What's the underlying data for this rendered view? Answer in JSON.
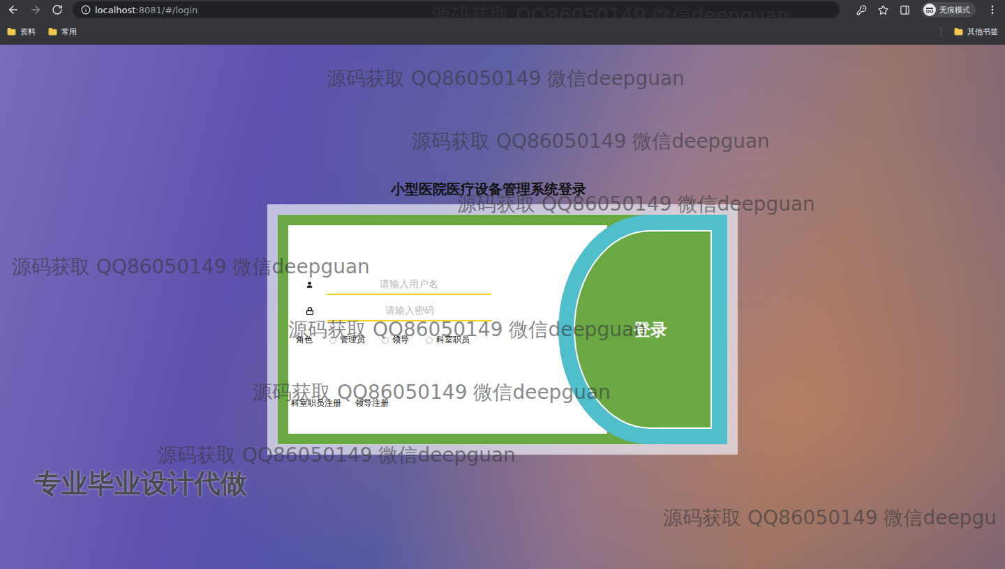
{
  "browser": {
    "url_host": "localhost",
    "url_path": ":8081/#/login",
    "profile": "无痕模式",
    "bookmarks": [
      "资料",
      "常用"
    ],
    "other_bookmarks": "其他书签"
  },
  "page": {
    "title": "小型医院医疗设备管理系统登录"
  },
  "form": {
    "username_placeholder": "请输入用户名",
    "password_placeholder": "请输入密码",
    "role_label": "角色",
    "roles": [
      {
        "label": "管理员",
        "selected": false
      },
      {
        "label": "领导",
        "selected": false
      },
      {
        "label": "科室职员",
        "selected": false
      }
    ],
    "login_button": "登录",
    "links": [
      "科室职员注册",
      "领导注册"
    ]
  },
  "watermarks": [
    "源码获取 QQ86050149 微信deepguan",
    "源码获取 QQ86050149 微信deepguan",
    "源码获取 QQ86050149 微信deepguan",
    "源码获取 QQ86050149 微信deepguan",
    "源码获取 QQ86050149 微信deepguan",
    "源码获取 QQ86050149 微信deepguan",
    "源码获取 QQ86050149 微信deepguan",
    "源码获取 QQ86050149 微信deepguan",
    "源码获取 QQ86050149 微信deepgu"
  ],
  "banner": "专业毕业设计代做"
}
